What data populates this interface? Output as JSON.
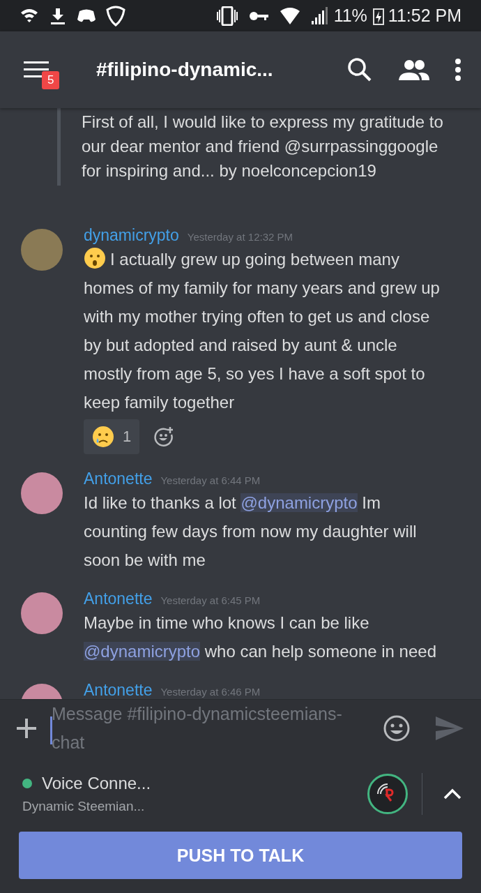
{
  "status_bar": {
    "battery": "11%",
    "time": "11:52 PM"
  },
  "header": {
    "title": "#filipino-dynamic...",
    "badge": "5"
  },
  "quote": {
    "text": "First of all, I would like to express my gratitude to our dear mentor and friend @surrpassinggoogle for inspiring and... by noelconcepcion19"
  },
  "messages": [
    {
      "author": "dynamicrypto",
      "time": "Yesterday at 12:32 PM",
      "lead_emoji": true,
      "parts": [
        {
          "kind": "text",
          "text": "I actually grew up going between many homes of my family for many years and grew up with my mother trying often to get us and close by but adopted and raised by aunt & uncle mostly from age 5, so yes I have a soft spot to keep family together"
        }
      ],
      "reactions": [
        {
          "count": "1",
          "selected": false
        }
      ]
    },
    {
      "author": "Antonette",
      "time": "Yesterday at 6:44 PM",
      "lead_emoji": false,
      "parts": [
        {
          "kind": "text",
          "text": "Id like to thanks a lot "
        },
        {
          "kind": "mention",
          "text": "@dynamicrypto"
        },
        {
          "kind": "text",
          "text": " Im counting few days from now my daughter will soon be with me"
        }
      ]
    },
    {
      "author": "Antonette",
      "time": "Yesterday at 6:45 PM",
      "lead_emoji": false,
      "parts": [
        {
          "kind": "text",
          "text": "Maybe in time who knows I can be like "
        },
        {
          "kind": "mention",
          "text": "@dynamicrypto"
        },
        {
          "kind": "text",
          "text": " who can help someone in need"
        }
      ]
    },
    {
      "author": "Antonette",
      "time": "Yesterday at 6:46 PM"
    }
  ],
  "composer": {
    "placeholder": "Message #filipino-dynamicsteemians-chat"
  },
  "voice": {
    "status": "Voice Conne...",
    "channel": "Dynamic Steemian...",
    "connected": true
  },
  "push_button": "PUSH TO TALK"
}
